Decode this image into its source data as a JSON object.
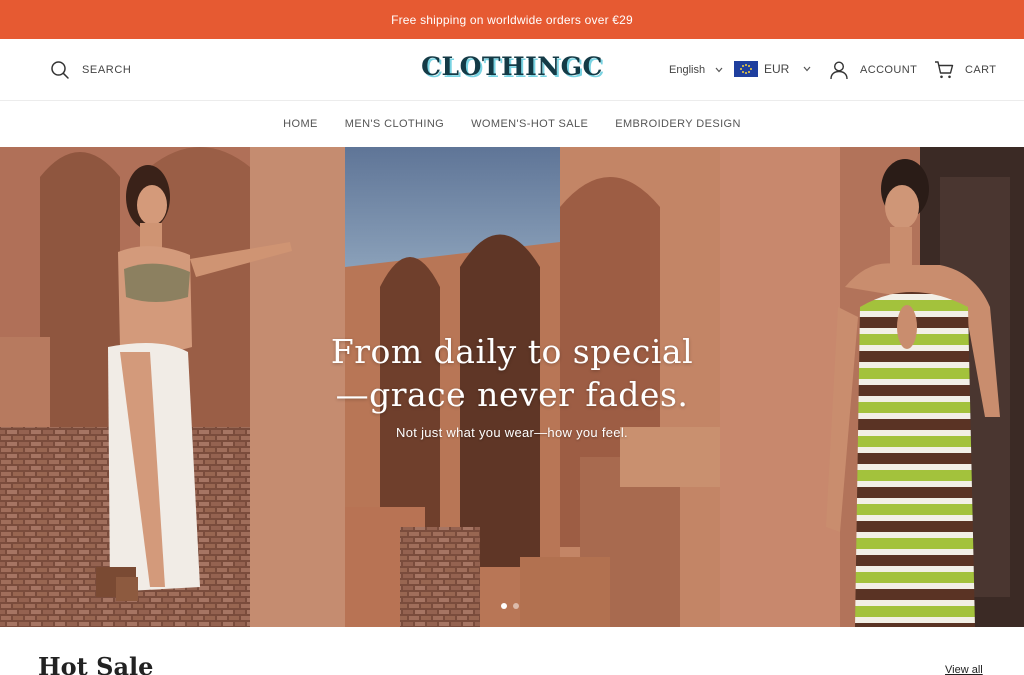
{
  "announcement": {
    "text": "Free shipping on worldwide orders over €29"
  },
  "header": {
    "search_label": "SEARCH",
    "logo": "CLOTHINGC",
    "language": "English",
    "currency": "EUR",
    "account_label": "ACCOUNT",
    "cart_label": "CART"
  },
  "nav": {
    "items": [
      {
        "label": "HOME"
      },
      {
        "label": "MEN'S CLOTHING"
      },
      {
        "label": "WOMEN'S-HOT SALE"
      },
      {
        "label": "EMBROIDERY DESIGN"
      }
    ]
  },
  "hero": {
    "title_line1": "From daily to special",
    "title_line2": "—grace never fades.",
    "subtitle": "Not just what you wear—how you feel.",
    "slide_count": 2,
    "active_slide": 1
  },
  "section": {
    "title": "Hot Sale",
    "view_all": "View all"
  },
  "colors": {
    "announcement_bg": "#e65a32",
    "logo": "#143a46",
    "logo_shadow": "#79d3e2"
  },
  "icons": {
    "search": "search-icon",
    "account": "user-icon",
    "cart": "cart-icon",
    "chevron": "chevron-down-icon",
    "flag": "eu-flag-icon"
  }
}
